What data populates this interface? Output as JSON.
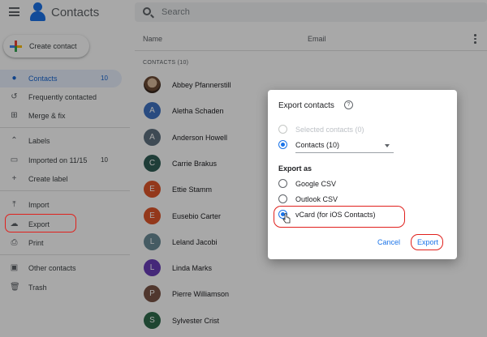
{
  "app": {
    "title": "Contacts"
  },
  "search": {
    "placeholder": "Search"
  },
  "create_contact": {
    "label": "Create contact"
  },
  "sidebar": {
    "items": [
      {
        "label": "Contacts",
        "count": "10",
        "icon": "person-icon"
      },
      {
        "label": "Frequently contacted",
        "icon": "history-icon"
      },
      {
        "label": "Merge & fix",
        "icon": "merge-icon"
      },
      {
        "label": "Labels",
        "icon": "chevron-up-icon"
      },
      {
        "label": "Imported on 11/15",
        "count": "10",
        "icon": "label-icon"
      },
      {
        "label": "Create label",
        "icon": "plus-icon"
      },
      {
        "label": "Import",
        "icon": "upload-icon"
      },
      {
        "label": "Export",
        "icon": "cloud-icon"
      },
      {
        "label": "Print",
        "icon": "printer-icon"
      },
      {
        "label": "Other contacts",
        "icon": "box-icon"
      },
      {
        "label": "Trash",
        "icon": "trash-icon"
      }
    ]
  },
  "list": {
    "col_name": "Name",
    "col_email": "Email",
    "section": "CONTACTS (10)",
    "contacts": [
      {
        "initial": "",
        "name": "Abbey Pfannerstill",
        "color": "#7b5b45"
      },
      {
        "initial": "A",
        "name": "Aletha Schaden",
        "color": "#3f73c2"
      },
      {
        "initial": "A",
        "name": "Anderson Howell",
        "color": "#5f7180"
      },
      {
        "initial": "C",
        "name": "Carrie Brakus",
        "color": "#2f5d55"
      },
      {
        "initial": "E",
        "name": "Ettie Stamm",
        "color": "#e0562a"
      },
      {
        "initial": "E",
        "name": "Eusebio Carter",
        "color": "#e0562a"
      },
      {
        "initial": "L",
        "name": "Leland Jacobi",
        "color": "#6a8a96"
      },
      {
        "initial": "L",
        "name": "Linda Marks",
        "color": "#6a3db8"
      },
      {
        "initial": "P",
        "name": "Pierre Williamson",
        "color": "#7a5446"
      },
      {
        "initial": "S",
        "name": "Sylvester Crist",
        "color": "#2f6b4d"
      }
    ]
  },
  "dialog": {
    "title": "Export contacts",
    "opt_selected": "Selected contacts (0)",
    "opt_contacts": "Contacts (10)",
    "export_as": "Export as",
    "formats": [
      "Google CSV",
      "Outlook CSV",
      "vCard (for iOS Contacts)"
    ],
    "selected_format": "vCard (for iOS Contacts)",
    "cancel": "Cancel",
    "export": "Export"
  },
  "colors": {
    "accent": "#1a73e8",
    "highlight": "#e0201c"
  }
}
